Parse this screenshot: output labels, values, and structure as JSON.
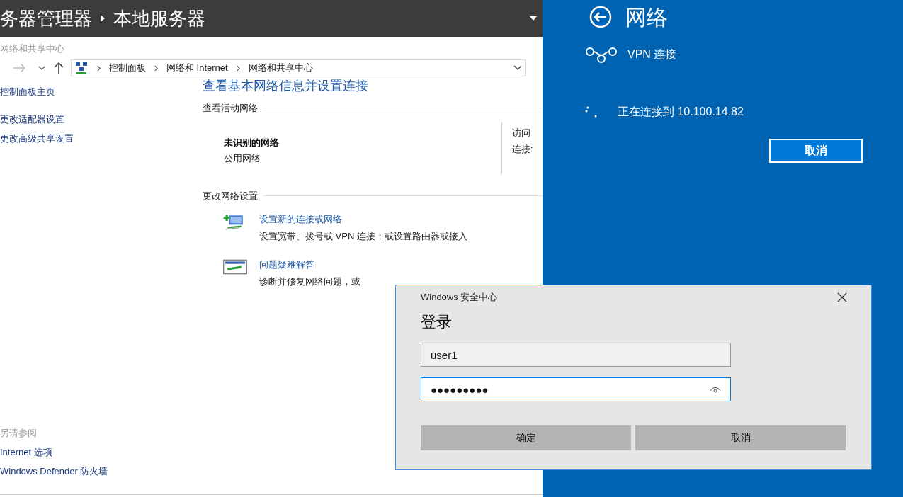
{
  "server_manager": {
    "title": "务器管理器",
    "page": "本地服务器"
  },
  "explorer": {
    "window_title": "网络和共享中心",
    "breadcrumbs": [
      "控制面板",
      "网络和 Internet",
      "网络和共享中心"
    ],
    "sidebar": {
      "links": [
        "控制面板主页",
        "更改适配器设置",
        "更改高级共享设置"
      ],
      "see_also_heading": "另请参阅",
      "see_also": [
        "Internet 选项",
        "Windows Defender 防火墙"
      ]
    },
    "heading": "查看基本网络信息并设置连接",
    "active_networks": {
      "label": "查看活动网络",
      "name": "未识别的网络",
      "type": "公用网络",
      "details": [
        "访问",
        "连接:"
      ]
    },
    "change_settings": {
      "label": "更改网络设置",
      "items": [
        {
          "kind": "new-connection",
          "title": "设置新的连接或网络",
          "description": "设置宽带、拨号或 VPN 连接；或设置路由器或接入"
        },
        {
          "kind": "troubleshoot",
          "title": "问题疑难解答",
          "description": "诊断并修复网络问题，或"
        }
      ]
    }
  },
  "network_panel": {
    "title": "网络",
    "vpn_label": "VPN 连接",
    "status": "正在连接到 10.100.14.82",
    "cancel": "取消"
  },
  "dialog": {
    "app": "Windows 安全中心",
    "title": "登录",
    "fields": [
      {
        "kind": "text",
        "value": "user1",
        "focused": false
      },
      {
        "kind": "password",
        "value": "●●●●●●●●●",
        "focused": true
      }
    ],
    "buttons": [
      "确定",
      "取消"
    ]
  }
}
